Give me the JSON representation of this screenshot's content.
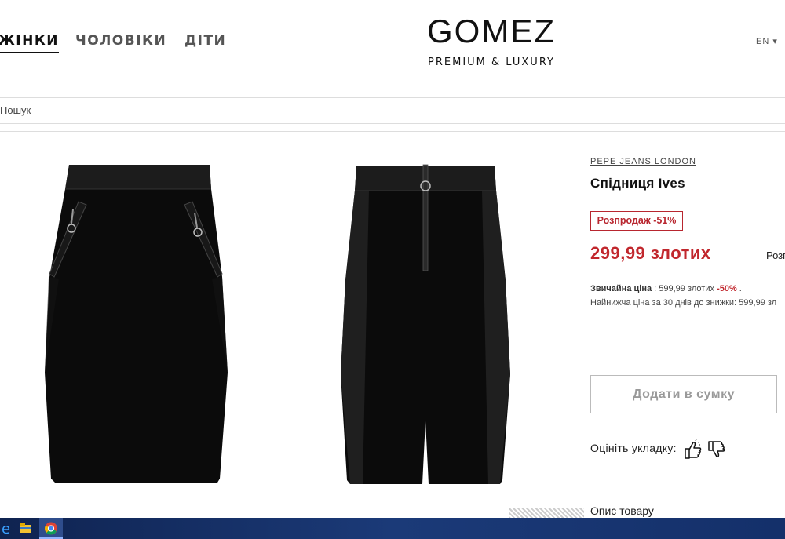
{
  "nav": {
    "women": "ЖІНКИ",
    "men": "ЧОЛОВІКИ",
    "kids": "ДІТИ"
  },
  "logo": {
    "brand": "GOMEZ",
    "tagline": "PREMIUM & LUXURY"
  },
  "lang": "EN ▾",
  "search": {
    "placeholder": "Пошук"
  },
  "product": {
    "brand": "PEPE JEANS LONDON",
    "title": "Спідниця Ives",
    "sale_badge": "Розпродаж -51%",
    "price": "299,99 злотих",
    "side_text": "Розп",
    "regular_label": "Звичайна ціна",
    "regular_sep": " : ",
    "regular_value": "599,99 злотих",
    "regular_discount": "-50%",
    "regular_end": " .",
    "lowest_text": "Найнижча ціна за 30 днів до знижки: 599,99 зл",
    "add_to_bag": "Додати в сумку",
    "rate_label": "Оцініть укладку:",
    "description_heading": "Опис товару"
  },
  "colors": {
    "sale_red": "#c1272d",
    "taskbar": "#1b3a78"
  },
  "icons": [
    "thumbs-up-icon",
    "thumbs-down-icon",
    "edge-icon",
    "file-explorer-icon",
    "chrome-icon"
  ]
}
